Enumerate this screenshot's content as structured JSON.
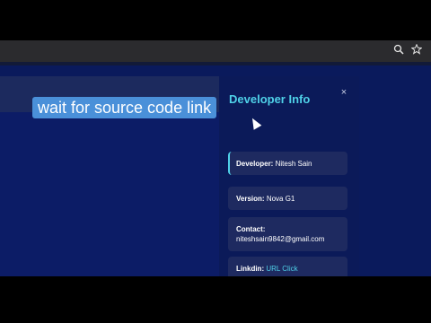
{
  "caption": "wait for source code link",
  "panel": {
    "title": "Developer Info",
    "close_label": "×",
    "developer_label": "Developer:",
    "developer_value": "Nitesh Sain",
    "version_label": "Version:",
    "version_value": "Nova G1",
    "contact_label": "Contact:",
    "contact_value": "niteshsain9842@gmail.com",
    "linkedin_label": "Linkdin:",
    "linkedin_value": "URL Click"
  },
  "browser": {
    "zoom_icon": "zoom-icon",
    "bookmark_icon": "star-icon"
  },
  "colors": {
    "accent": "#4fd1e8",
    "panel_bg": "#0b1a59",
    "card_bg": "#1e2a60",
    "caption_bg": "#4a90d9"
  }
}
